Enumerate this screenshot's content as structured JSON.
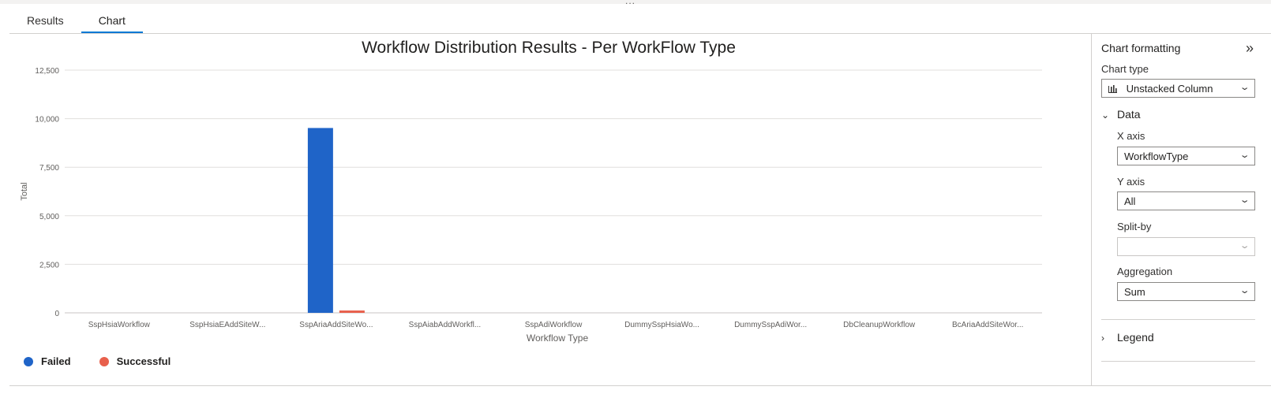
{
  "tabs": [
    {
      "label": "Results"
    },
    {
      "label": "Chart"
    }
  ],
  "grip": "...",
  "chart_data": {
    "type": "bar",
    "title": "Workflow Distribution Results - Per WorkFlow Type",
    "xlabel": "Workflow Type",
    "ylabel": "Total",
    "ylim": [
      0,
      12500
    ],
    "yticks": [
      "0",
      "2,500",
      "5,000",
      "7,500",
      "10,000",
      "12,500"
    ],
    "ytick_values": [
      0,
      2500,
      5000,
      7500,
      10000,
      12500
    ],
    "categories": [
      "SspHsiaWorkflow",
      "SspHsiaEAddSiteW...",
      "SspAriaAddSiteWo...",
      "SspAiabAddWorkfl...",
      "SspAdiWorkflow",
      "DummySspHsiaWo...",
      "DummySspAdiWor...",
      "DbCleanupWorkflow",
      "BcAriaAddSiteWor..."
    ],
    "series": [
      {
        "name": "Failed",
        "color": "#1f64c8",
        "values": [
          0,
          0,
          9520,
          0,
          0,
          0,
          0,
          0,
          0
        ]
      },
      {
        "name": "Successful",
        "color": "#e8604c",
        "values": [
          0,
          0,
          120,
          0,
          0,
          0,
          0,
          0,
          0
        ]
      }
    ],
    "grid": true,
    "legend": "bottom-left"
  },
  "panel": {
    "title": "Chart formatting",
    "collapse_icon": "double-chevron-right-icon",
    "chart_type_label": "Chart type",
    "chart_type_value": "Unstacked Column",
    "chart_type_icon": "column-chart-icon",
    "data_section": "Data",
    "x_axis_label": "X axis",
    "x_axis_value": "WorkflowType",
    "y_axis_label": "Y axis",
    "y_axis_value": "All",
    "split_by_label": "Split-by",
    "split_by_value": "",
    "aggregation_label": "Aggregation",
    "aggregation_value": "Sum",
    "legend_section": "Legend"
  }
}
